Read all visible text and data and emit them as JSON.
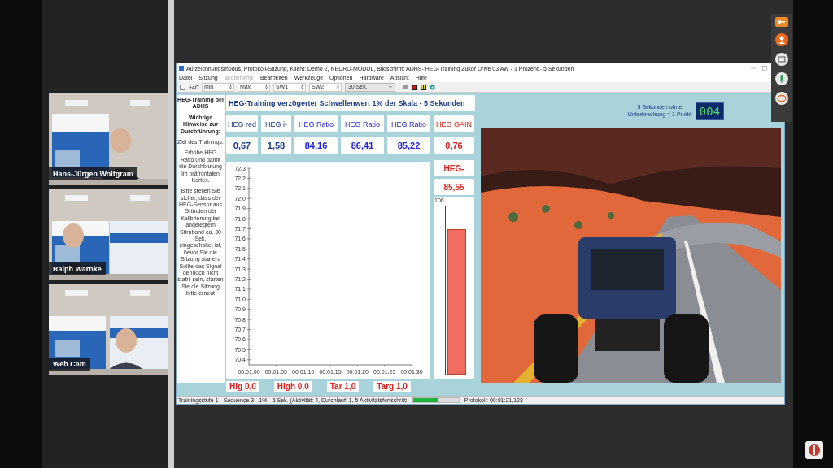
{
  "participants": [
    {
      "name": "Hans-Jürgen Wolfgram"
    },
    {
      "name": "Ralph Warnke"
    },
    {
      "name": "Web Cam"
    }
  ],
  "window": {
    "title": "Aufzeichnungsmodus, Protokoll-Sitzung, Klient: Demo 2, NEURO-MODUL, Bildschirm: ADHS- HEG-Training Zukor Drive 03 AW - 1 Prozent - 5 Sekunden"
  },
  "menu": [
    {
      "label": "Datei",
      "disabled": false
    },
    {
      "label": "Sitzung",
      "disabled": false
    },
    {
      "label": "Bildschirme",
      "disabled": true
    },
    {
      "label": "Bearbeiten",
      "disabled": false
    },
    {
      "label": "Werkzeuge",
      "disabled": false
    },
    {
      "label": "Optionen",
      "disabled": false
    },
    {
      "label": "Hardware",
      "disabled": false
    },
    {
      "label": "Ansicht",
      "disabled": false
    },
    {
      "label": "Hilfe",
      "disabled": false
    }
  ],
  "toolbar": [
    {
      "kind": "check",
      "checked": false
    },
    {
      "kind": "text",
      "label": "+40"
    },
    {
      "kind": "spin",
      "value": "Min"
    },
    {
      "kind": "spin",
      "value": "Max"
    },
    {
      "kind": "spin",
      "value": "SW1"
    },
    {
      "kind": "spin",
      "value": "SW2"
    },
    {
      "kind": "combo",
      "value": "30 Sek."
    }
  ],
  "notes": {
    "heading": "HEG-Training bei ADHS",
    "subheading": "Wichtige Hinweise zur Durchführung:",
    "goal_label": "Ziel des Trainings:",
    "goal": "Erhöhe HEG Ratio und damit die Durchblutung im präfrontalen Kortex.",
    "instructions": "Bitte stellen Sie sicher, dass der HEG-Sensor aus Gründen der Kalibrierung bei angelegtem Stirnband ca. 30 Sek. eingeschaltet ist, bevor Sie die Sitzung starten. Sollte das Signal dennoch nicht stabil sein, starten Sie die Sitzung bitte erneut"
  },
  "screen_title": "HEG-Training verzögerter Schwellenwert 1% der Skala - 5 Sekunden",
  "metrics": [
    {
      "kind": "plain",
      "label": "HEG red",
      "value": "0,67"
    },
    {
      "kind": "plain",
      "label": "HEG i-",
      "value": "1,58"
    },
    {
      "kind": "ratio",
      "label": "HEG Ratio",
      "value": "84,16"
    },
    {
      "kind": "ratio",
      "label": "HEG Ratio",
      "value": "86,41"
    },
    {
      "kind": "ratio",
      "label": "HEG Ratio",
      "value": "85,22"
    },
    {
      "kind": "gain",
      "label": "HEG GAIN",
      "value": "0,76"
    }
  ],
  "chart": {
    "chart_data": {
      "type": "line",
      "xlim": [
        60,
        90
      ],
      "ylim": [
        70.35,
        72.3
      ],
      "xticks": [
        {
          "value": 60,
          "label": "00:01:00"
        },
        {
          "value": 65,
          "label": "00:01:05"
        },
        {
          "value": 70,
          "label": "00:01:10"
        },
        {
          "value": 75,
          "label": "00:01:15"
        },
        {
          "value": 80,
          "label": "00:01:20"
        },
        {
          "value": 85,
          "label": "00:01:25"
        },
        {
          "value": 90,
          "label": "00:01:30"
        }
      ],
      "yticks": [
        {
          "value": 70.4,
          "label": "70.4"
        },
        {
          "value": 70.5,
          "label": "70.5"
        },
        {
          "value": 70.6,
          "label": "70.6"
        },
        {
          "value": 70.7,
          "label": "70.7"
        },
        {
          "value": 70.8,
          "label": "70.8"
        },
        {
          "value": 70.9,
          "label": "70.9"
        },
        {
          "value": 71.0,
          "label": "71.0"
        },
        {
          "value": 71.1,
          "label": "71.1"
        },
        {
          "value": 71.2,
          "label": "71.2"
        },
        {
          "value": 71.3,
          "label": "71.3"
        },
        {
          "value": 71.4,
          "label": "71.4"
        },
        {
          "value": 71.5,
          "label": "71.5"
        },
        {
          "value": 71.6,
          "label": "71.6"
        },
        {
          "value": 71.7,
          "label": "71.7"
        },
        {
          "value": 71.8,
          "label": "71.8"
        },
        {
          "value": 71.9,
          "label": "71.9"
        },
        {
          "value": 72.0,
          "label": "72.0"
        },
        {
          "value": 72.1,
          "label": "72.1"
        },
        {
          "value": 72.2,
          "label": "72.2"
        },
        {
          "value": 72.3,
          "label": "72.3"
        }
      ]
    }
  },
  "meter": {
    "label": "HEG-",
    "value": "85,55",
    "tick": "100",
    "level": 0.86
  },
  "thresholds": [
    {
      "label": "Hig 0,0"
    },
    {
      "label": "High 0,0"
    },
    {
      "label": "Tar 1,0"
    },
    {
      "label": "Targ 1,0"
    }
  ],
  "reward": {
    "text": "5 Sekunden ohne Unterbrechung = 1 Punkt",
    "counter": "004"
  },
  "status_bar": {
    "text": "Trainingsstufe 1 - Sequence 3 - 1% - 5 Sek. (Aktivität: 4, Durchlauf: 1, 5 Aktivitätsfortschritt:",
    "level": 0.55,
    "protocol": "Protokoll: 00:01:21,123"
  }
}
